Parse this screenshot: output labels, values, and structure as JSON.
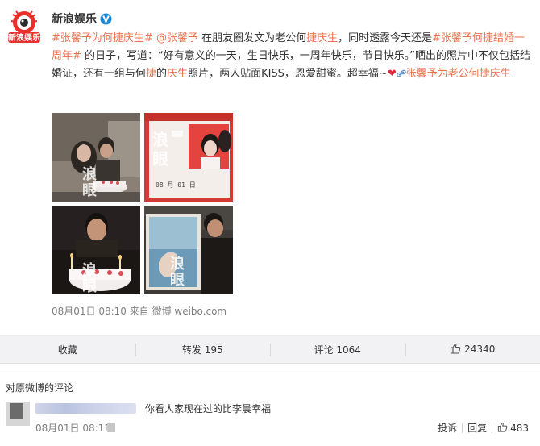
{
  "post": {
    "author": "新浪娱乐",
    "content": {
      "tag1": "#张馨予为何捷庆生#",
      "mention": "@张馨予",
      "t1": " 在朋友圈发文为老公何",
      "hl1": "捷庆生",
      "t2": "，同时透露今天还是",
      "tag2": "#张馨予何捷结婚一周年#",
      "t3": " 的日子，写道：“好有意义的一天，生日快乐，一周年快乐，节日快乐。”晒出的照片中不仅包括结婚证，还有一组与何",
      "hl2": "捷",
      "t4": "的",
      "hl3": "庆生",
      "t5": "照片，两人贴面KISS，恩爱甜蜜。超幸福~",
      "heart": "❤",
      "link_text": "张馨予为老公何",
      "link_hl": "捷庆生"
    },
    "meta": "08月01日 08:10  来自 微博 weibo.com"
  },
  "actions": {
    "collect": "收藏",
    "repost": "转发 195",
    "comment": "评论 1064",
    "like_count": "24340"
  },
  "comments": {
    "header": "对原微博的评论",
    "text": "你看人家现在过的比李晨幸福",
    "meta": "08月01日 08:11",
    "report": "投诉",
    "reply": "回复",
    "like_count": "483"
  },
  "colors": {
    "accent": "#eb7350",
    "action_bar": "#f2f2f5"
  }
}
